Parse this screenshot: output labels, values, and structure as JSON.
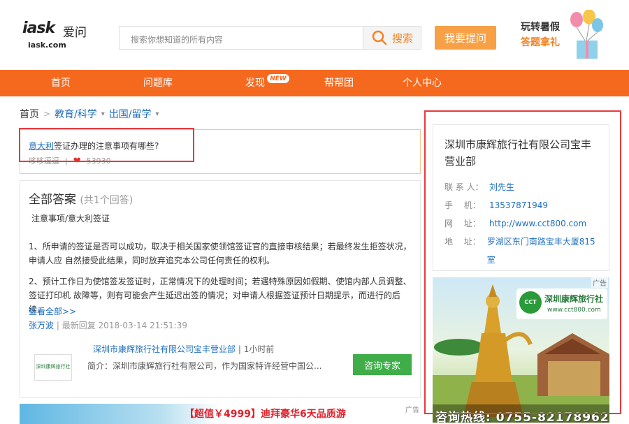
{
  "header": {
    "logo_mark": "iask",
    "logo_cn": "爱问",
    "logo_url": "iask.com",
    "search_placeholder": "搜索你想知道的所有内容",
    "search_button": "搜索",
    "ask_button": "我要提问",
    "promo_line1": "玩转暑假",
    "promo_line2": "答题拿礼"
  },
  "nav": {
    "items": [
      "首页",
      "问题库",
      "发现",
      "帮帮团",
      "个人中心"
    ],
    "new_badge": "NEW"
  },
  "breadcrumb": {
    "home": "首页",
    "sep": ">",
    "cat1": "教育/科学",
    "cat2": "出国/留学"
  },
  "question": {
    "keyword": "意大利",
    "title_rest": "签证办理的注意事项有哪些?",
    "author": "哆哆逗逗",
    "views": "53930"
  },
  "answers": {
    "heading": "全部答案",
    "count": "(共1个回答)",
    "lines": [
      "注意事项/意大利签证",
      "1、所申请的签证是否可以成功，取决于相关国家使领馆签证官的直接审核结果；若最终发生拒签状况，申请人应 自然接受此结果，同时放弃追究本公司任何责任的权利。",
      "2、预计工作日为使馆签发签证时，正常情况下的处理时间；若遇特殊原因如假期、使馆内部人员调整、签证打印机 故障等，则有可能会产生延迟出签的情况；对申请人根据签证预计日期提示，而进行的后续..."
    ],
    "more": "查看全部>>",
    "answer_author": "张万波",
    "reply_label": "最新回复",
    "reply_time": "2018-03-14 21:51:39",
    "ad": {
      "logo_text": "深圳康辉旅行社",
      "title": "深圳市康辉旅行社有限公司宝丰营业部",
      "time": "1小时前",
      "intro": "简介：深圳市康辉旅行社有限公司，作为国家特许经营中国公...",
      "consult": "咨询专家"
    }
  },
  "banner": {
    "text": "【超值￥4999】迪拜豪华6天品质游",
    "tag": "广告"
  },
  "company": {
    "name": "深圳市康辉旅行社有限公司宝丰营业部",
    "rows": [
      {
        "label": "联 系 人：",
        "value": "刘先生"
      },
      {
        "label": "手　 机：",
        "value": "13537871949"
      },
      {
        "label": "网　 址：",
        "value": "http://www.cct800.com"
      },
      {
        "label": "地　 址：",
        "value": "罗湖区东门南路宝丰大厦815室"
      }
    ]
  },
  "side_ad": {
    "tag": "广告",
    "cct": "CCT",
    "brand": "深圳康辉旅行社",
    "url": "www.cct800.com",
    "hotline": "咨询热线: 0755-82178962"
  },
  "colors": {
    "accent_orange": "#f5691e",
    "link_blue": "#1f6fbf",
    "highlight_red": "#e83a3a",
    "consult_green": "#3fae49"
  }
}
